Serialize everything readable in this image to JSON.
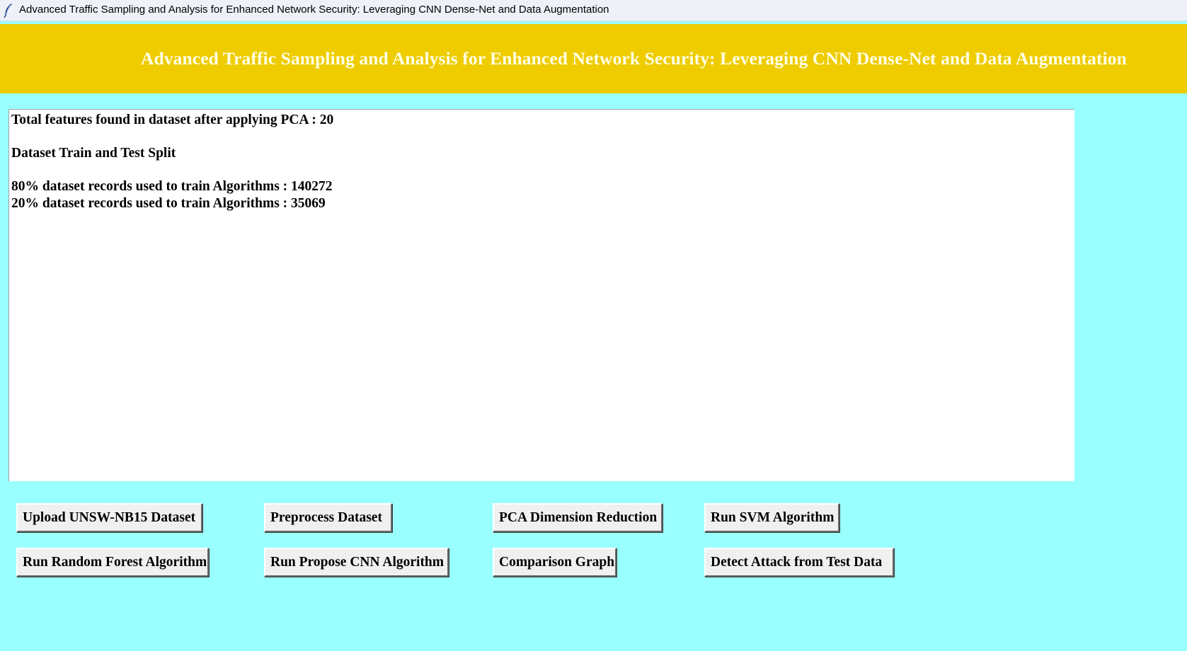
{
  "window": {
    "title": "Advanced Traffic Sampling and Analysis for Enhanced Network Security: Leveraging CNN Dense-Net and Data Augmentation",
    "icon": "feather-icon"
  },
  "header": {
    "title": "Advanced Traffic Sampling and Analysis for Enhanced Network Security: Leveraging CNN Dense-Net and Data Augmentation"
  },
  "output": {
    "lines": [
      "Total features found in dataset after applying PCA : 20",
      "",
      "Dataset Train and Test Split",
      "",
      "80% dataset records used to train Algorithms : 140272",
      "20% dataset records used to train Algorithms : 35069"
    ]
  },
  "buttons": {
    "upload": "Upload UNSW-NB15 Dataset",
    "preprocess": "Preprocess Dataset",
    "pca": "PCA Dimension Reduction",
    "svm": "Run SVM Algorithm",
    "random_forest": "Run Random Forest Algorithm",
    "cnn": "Run Propose CNN Algorithm",
    "graph": "Comparison Graph",
    "detect": "Detect Attack from Test Data"
  },
  "colors": {
    "background": "#99ffff",
    "header": "#eecc00",
    "header_text": "#ffffe6",
    "output_bg": "#ffffff",
    "button_bg": "#f0f0f0"
  }
}
